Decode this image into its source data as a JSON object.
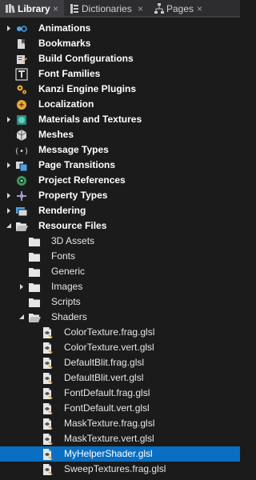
{
  "tabs": [
    {
      "label": "Library",
      "icon": "library-icon",
      "close": "×",
      "active": true
    },
    {
      "label": "Dictionaries",
      "icon": "dictionaries-icon",
      "close": "×",
      "active": false
    },
    {
      "label": "Pages",
      "icon": "pages-icon",
      "close": "×",
      "active": false
    }
  ],
  "tree": {
    "colors": {
      "selected_bg": "#0a6fc2",
      "background": "#1b1b1c"
    },
    "items": [
      {
        "label": "Animations",
        "icon": "animations-icon",
        "level": 0,
        "expander": "collapsed"
      },
      {
        "label": "Bookmarks",
        "icon": "bookmarks-icon",
        "level": 0,
        "expander": "none"
      },
      {
        "label": "Build Configurations",
        "icon": "build-configurations-icon",
        "level": 0,
        "expander": "none"
      },
      {
        "label": "Font Families",
        "icon": "font-families-icon",
        "level": 0,
        "expander": "none"
      },
      {
        "label": "Kanzi Engine Plugins",
        "icon": "plugins-icon",
        "level": 0,
        "expander": "none"
      },
      {
        "label": "Localization",
        "icon": "localization-icon",
        "level": 0,
        "expander": "none"
      },
      {
        "label": "Materials and Textures",
        "icon": "materials-icon",
        "level": 0,
        "expander": "collapsed"
      },
      {
        "label": "Meshes",
        "icon": "meshes-icon",
        "level": 0,
        "expander": "none"
      },
      {
        "label": "Message Types",
        "icon": "message-types-icon",
        "level": 0,
        "expander": "none"
      },
      {
        "label": "Page Transitions",
        "icon": "page-transitions-icon",
        "level": 0,
        "expander": "collapsed"
      },
      {
        "label": "Project References",
        "icon": "project-references-icon",
        "level": 0,
        "expander": "none"
      },
      {
        "label": "Property Types",
        "icon": "property-types-icon",
        "level": 0,
        "expander": "collapsed"
      },
      {
        "label": "Rendering",
        "icon": "rendering-icon",
        "level": 0,
        "expander": "collapsed"
      },
      {
        "label": "Resource Files",
        "icon": "folder-open-icon",
        "level": 0,
        "expander": "expanded"
      },
      {
        "label": "3D Assets",
        "icon": "folder-icon",
        "level": 1,
        "expander": "none"
      },
      {
        "label": "Fonts",
        "icon": "folder-icon",
        "level": 1,
        "expander": "none"
      },
      {
        "label": "Generic",
        "icon": "folder-icon",
        "level": 1,
        "expander": "none"
      },
      {
        "label": "Images",
        "icon": "folder-icon",
        "level": 1,
        "expander": "collapsed"
      },
      {
        "label": "Scripts",
        "icon": "folder-icon",
        "level": 1,
        "expander": "none"
      },
      {
        "label": "Shaders",
        "icon": "folder-open-icon",
        "level": 1,
        "expander": "expanded"
      },
      {
        "label": "ColorTexture.frag.glsl",
        "icon": "shader-file-icon",
        "level": 2,
        "expander": "none"
      },
      {
        "label": "ColorTexture.vert.glsl",
        "icon": "shader-file-icon",
        "level": 2,
        "expander": "none"
      },
      {
        "label": "DefaultBlit.frag.glsl",
        "icon": "shader-file-icon",
        "level": 2,
        "expander": "none"
      },
      {
        "label": "DefaultBlit.vert.glsl",
        "icon": "shader-file-icon",
        "level": 2,
        "expander": "none"
      },
      {
        "label": "FontDefault.frag.glsl",
        "icon": "shader-file-icon",
        "level": 2,
        "expander": "none"
      },
      {
        "label": "FontDefault.vert.glsl",
        "icon": "shader-file-icon",
        "level": 2,
        "expander": "none"
      },
      {
        "label": "MaskTexture.frag.glsl",
        "icon": "shader-file-icon",
        "level": 2,
        "expander": "none"
      },
      {
        "label": "MaskTexture.vert.glsl",
        "icon": "shader-file-icon",
        "level": 2,
        "expander": "none"
      },
      {
        "label": "MyHelperShader.glsl",
        "icon": "shader-file-icon",
        "level": 2,
        "expander": "none",
        "selected": true
      },
      {
        "label": "SweepTextures.frag.glsl",
        "icon": "shader-file-icon",
        "level": 2,
        "expander": "none"
      }
    ]
  }
}
